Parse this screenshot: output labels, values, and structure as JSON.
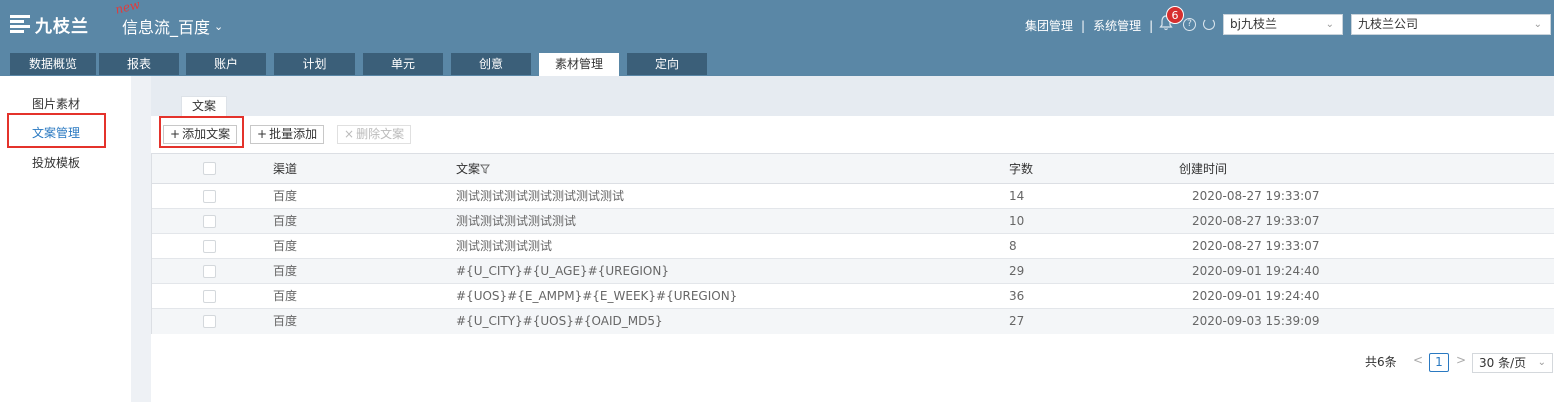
{
  "header": {
    "logo_text": "九枝兰",
    "new_tag": "new",
    "product_title": "信息流_百度",
    "links": [
      "集团管理",
      "系统管理"
    ],
    "link_separator": "|",
    "notification_count": "6",
    "account_select": "bj九枝兰",
    "company_select": "九枝兰公司"
  },
  "tabs": [
    {
      "label": "数据概览"
    },
    {
      "label": "报表"
    },
    {
      "label": "账户"
    },
    {
      "label": "计划"
    },
    {
      "label": "单元"
    },
    {
      "label": "创意"
    },
    {
      "label": "素材管理"
    },
    {
      "label": "定向"
    }
  ],
  "sidebar": {
    "items": [
      {
        "label": "图片素材"
      },
      {
        "label": "文案管理"
      },
      {
        "label": "投放模板"
      }
    ]
  },
  "subtab": "文案",
  "toolbar": {
    "add": "添加文案",
    "batch_add": "批量添加",
    "delete": "删除文案",
    "plus": "+",
    "cross": "×"
  },
  "table": {
    "headers": [
      "渠道",
      "文案",
      "字数",
      "创建时间"
    ],
    "filter_icon": "filter-icon",
    "rows": [
      {
        "channel": "百度",
        "text": "测试测试测试测试测试测试测试",
        "count": "14",
        "created": "2020-08-27 19:33:07"
      },
      {
        "channel": "百度",
        "text": "测试测试测试测试测试",
        "count": "10",
        "created": "2020-08-27 19:33:07"
      },
      {
        "channel": "百度",
        "text": "测试测试测试测试",
        "count": "8",
        "created": "2020-08-27 19:33:07"
      },
      {
        "channel": "百度",
        "text": "#{U_CITY}#{U_AGE}#{UREGION}",
        "count": "29",
        "created": "2020-09-01 19:24:40"
      },
      {
        "channel": "百度",
        "text": "#{UOS}#{E_AMPM}#{E_WEEK}#{UREGION}",
        "count": "36",
        "created": "2020-09-01 19:24:40"
      },
      {
        "channel": "百度",
        "text": "#{U_CITY}#{UOS}#{OAID_MD5}",
        "count": "27",
        "created": "2020-09-03 15:39:09"
      }
    ]
  },
  "pagination": {
    "total": "共6条",
    "current_page": "1",
    "page_size": "30 条/页",
    "prev": "<",
    "next": ">"
  },
  "colors": {
    "header_bg": "#5a87a6",
    "tab_bg": "#3b5f79",
    "accent": "#2a79c1",
    "highlight": "#e4322b",
    "badge": "#d62f2f"
  }
}
